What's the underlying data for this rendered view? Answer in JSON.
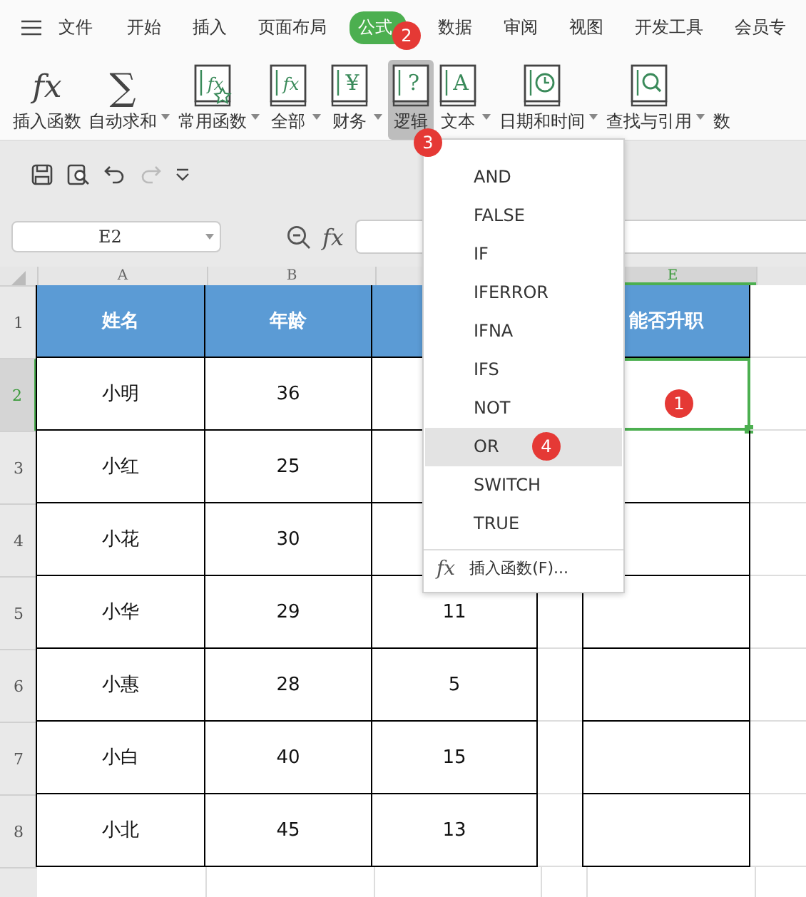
{
  "ribbon_tabs": [
    {
      "label": "文件",
      "selected": false
    },
    {
      "label": "开始",
      "selected": false
    },
    {
      "label": "插入",
      "selected": false
    },
    {
      "label": "页面布局",
      "selected": false
    },
    {
      "label": "公式",
      "selected": true
    },
    {
      "label": "数据",
      "selected": false
    },
    {
      "label": "审阅",
      "selected": false
    },
    {
      "label": "视图",
      "selected": false
    },
    {
      "label": "开发工具",
      "selected": false
    },
    {
      "label": "会员专",
      "selected": false
    }
  ],
  "toolbar": [
    {
      "label": "插入函数",
      "glyph": "fx",
      "dropdown": false,
      "selected": false
    },
    {
      "label": "自动求和",
      "glyph": "∑",
      "dropdown": true,
      "selected": false
    },
    {
      "label": "常用函数",
      "glyph": "fx",
      "dropdown": true,
      "selected": false
    },
    {
      "label": "全部",
      "glyph": "fx",
      "dropdown": true,
      "selected": false
    },
    {
      "label": "财务",
      "glyph": "¥",
      "dropdown": true,
      "selected": false
    },
    {
      "label": "逻辑",
      "glyph": "?",
      "dropdown": false,
      "selected": true
    },
    {
      "label": "文本",
      "glyph": "A",
      "dropdown": true,
      "selected": false
    },
    {
      "label": "日期和时间",
      "dropdown": true,
      "selected": false
    },
    {
      "label": "查找与引用",
      "dropdown": true,
      "selected": false
    },
    {
      "label": "数",
      "dropdown": false,
      "selected": false
    }
  ],
  "name_box": {
    "value": "E2"
  },
  "formula_bar": {
    "fx": "fx"
  },
  "columns": [
    {
      "label": "A",
      "selected": false
    },
    {
      "label": "B",
      "selected": false
    },
    {
      "label": "E",
      "selected": true
    }
  ],
  "rows": [
    {
      "number": "1",
      "selected": false,
      "kind": "header",
      "cells": [
        "姓名",
        "年龄",
        null,
        null,
        "能否升职",
        null
      ]
    },
    {
      "number": "2",
      "selected": true,
      "kind": "data",
      "cells": [
        "小明",
        "36",
        null,
        null,
        null,
        null
      ]
    },
    {
      "number": "3",
      "selected": false,
      "kind": "data",
      "cells": [
        "小红",
        "25",
        null,
        null,
        null,
        null
      ]
    },
    {
      "number": "4",
      "selected": false,
      "kind": "data",
      "cells": [
        "小花",
        "30",
        null,
        null,
        null,
        null
      ]
    },
    {
      "number": "5",
      "selected": false,
      "kind": "data",
      "cells": [
        "小华",
        "29",
        "11",
        null,
        null,
        null
      ]
    },
    {
      "number": "6",
      "selected": false,
      "kind": "data",
      "cells": [
        "小惠",
        "28",
        "5",
        null,
        null,
        null
      ]
    },
    {
      "number": "7",
      "selected": false,
      "kind": "data",
      "cells": [
        "小白",
        "40",
        "15",
        null,
        null,
        null
      ]
    },
    {
      "number": "8",
      "selected": false,
      "kind": "data",
      "cells": [
        "小北",
        "45",
        "13",
        null,
        null,
        null
      ]
    }
  ],
  "dropdown_menu": {
    "items": [
      {
        "label": "AND",
        "selected": false
      },
      {
        "label": "FALSE",
        "selected": false
      },
      {
        "label": "IF",
        "selected": false
      },
      {
        "label": "IFERROR",
        "selected": false
      },
      {
        "label": "IFNA",
        "selected": false
      },
      {
        "label": "IFS",
        "selected": false
      },
      {
        "label": "NOT",
        "selected": false
      },
      {
        "label": "OR",
        "selected": true
      },
      {
        "label": "SWITCH",
        "selected": false
      },
      {
        "label": "TRUE",
        "selected": false
      }
    ],
    "footer": {
      "icon": "fx",
      "label": "插入函数(F)..."
    }
  },
  "step_badges": [
    "1",
    "2",
    "3",
    "4"
  ]
}
